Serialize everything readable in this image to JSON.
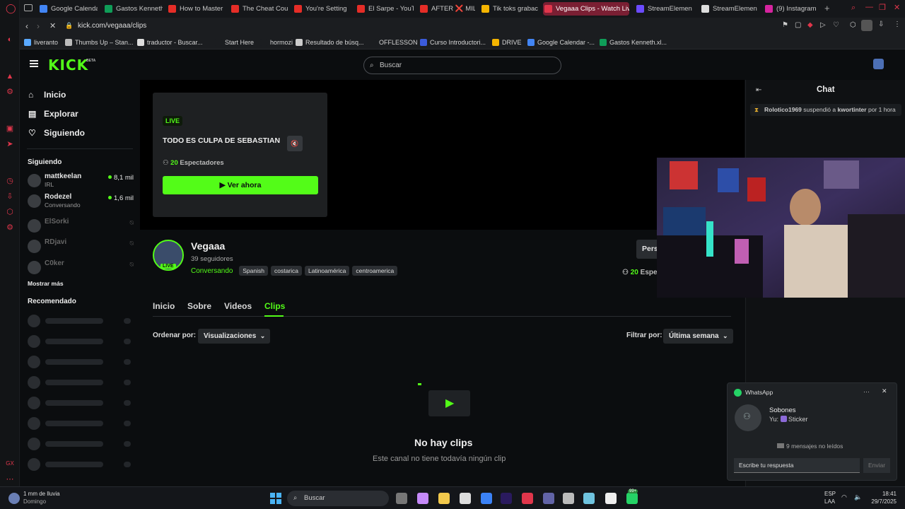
{
  "browser": {
    "tabs": [
      {
        "label": "Google Calenda",
        "icon": "calendar-icon",
        "color": "#4285f4"
      },
      {
        "label": "Gastos Kenneth",
        "icon": "sheets-icon",
        "color": "#0f9d58"
      },
      {
        "label": "How to Master",
        "icon": "youtube-icon",
        "color": "#e52d27"
      },
      {
        "label": "The Cheat Cou",
        "icon": "youtube-icon",
        "color": "#e52d27"
      },
      {
        "label": "You're Setting",
        "icon": "youtube-icon",
        "color": "#e52d27"
      },
      {
        "label": "El Sarpe - YouT",
        "icon": "youtube-icon",
        "color": "#e52d27"
      },
      {
        "label": "AFTER ❌ MIL",
        "icon": "youtube-icon",
        "color": "#e52d27"
      },
      {
        "label": "Tik toks grabac",
        "icon": "drive-icon",
        "color": "#f4b400"
      },
      {
        "label": "Vegaaa Clips - Watch Liv",
        "icon": "opera-icon",
        "color": "#e0364b"
      },
      {
        "label": "StreamElemen",
        "icon": "streamelements-icon",
        "color": "#6b4bff"
      },
      {
        "label": "StreamElemen",
        "icon": "github-icon",
        "color": "#ddd"
      },
      {
        "label": "(9) Instagram",
        "icon": "instagram-icon",
        "color": "#d6249f"
      }
    ],
    "url": "kick.com/vegaaa/clips",
    "bookmarks": [
      {
        "label": "liveranto",
        "color": "#5aa9ff"
      },
      {
        "label": "Thumbs Up – Stan...",
        "color": "#bbb"
      },
      {
        "label": "traductor - Buscar...",
        "color": "#ddd"
      },
      {
        "label": "Start Here",
        "color": "#1b1d20"
      },
      {
        "label": "hormozi",
        "color": "#1b1d20"
      },
      {
        "label": "Resultado de búsq...",
        "color": "#ccc"
      },
      {
        "label": "OFFLESSON",
        "color": "#1b1d20"
      },
      {
        "label": "Curso Introductori...",
        "color": "#3b5bdb"
      },
      {
        "label": "DRIVE",
        "color": "#f4b400"
      },
      {
        "label": "Google Calendar -...",
        "color": "#4285f4"
      },
      {
        "label": "Gastos Kenneth.xl...",
        "color": "#0f9d58"
      }
    ]
  },
  "kick": {
    "logo": "KICK",
    "beta": "BETA",
    "search_placeholder": "Buscar",
    "nav": [
      "Inicio",
      "Explorar",
      "Siguiendo"
    ],
    "following_title": "Siguiendo",
    "following": [
      {
        "name": "mattkeelan",
        "sub": "IRL",
        "viewers": "8,1 mil",
        "live": true
      },
      {
        "name": "Rodezel",
        "sub": "Conversando",
        "viewers": "1,6 mil",
        "live": true
      },
      {
        "name": "ElSorki",
        "sub": "",
        "viewers": "",
        "live": false
      },
      {
        "name": "RDjavi",
        "sub": "",
        "viewers": "",
        "live": false
      },
      {
        "name": "C0ker",
        "sub": "",
        "viewers": "",
        "live": false
      }
    ],
    "show_more": "Mostrar más",
    "recommended_title": "Recomendado",
    "livecard": {
      "badge": "LIVE",
      "title": "TODO ES CULPA DE SEBASTIAN",
      "viewers_count": "20",
      "viewers_label": "Espectadores",
      "watch_button": "Ver ahora"
    },
    "channel": {
      "name": "Vegaaa",
      "followers": "39 seguidores",
      "category": "Conversando",
      "tags": [
        "Spanish",
        "costarica",
        "Latinoamérica",
        "centroamerica"
      ],
      "live_badge": "LIVE",
      "personalize_btn": "Pers",
      "viewers_count": "20",
      "viewers_label": "Espe"
    },
    "channel_tabs": [
      "Inicio",
      "Sobre",
      "Videos",
      "Clips"
    ],
    "sort_label": "Ordenar por:",
    "sort_value": "Visualizaciones",
    "filter_label": "Filtrar por:",
    "filter_value": "Última semana",
    "empty_title": "No hay clips",
    "empty_sub": "Este canal no tiene todavía ningún clip",
    "chat_title": "Chat",
    "chat_event": {
      "user": "Rolotico1969",
      "text": "suspendió a",
      "target": "kwortinter",
      "duration": "por 1 hora"
    }
  },
  "whatsapp": {
    "app": "WhatsApp",
    "contact": "Sobones",
    "preview_prefix": "Yu:",
    "preview": "Sticker",
    "unread": "9 mensajes no leídos",
    "reply_placeholder": "Escribe tu respuesta",
    "send": "Enviar"
  },
  "taskbar": {
    "weather": "1 mm de lluvia",
    "weather_day": "Domingo",
    "search": "Buscar",
    "lang": "ESP",
    "lang_sub": "LAA",
    "time": "18:41",
    "date": "29/7/2025",
    "notif_badge": "99+"
  },
  "colors": {
    "kick_green": "#53fc18",
    "opera_red": "#e0364b"
  }
}
